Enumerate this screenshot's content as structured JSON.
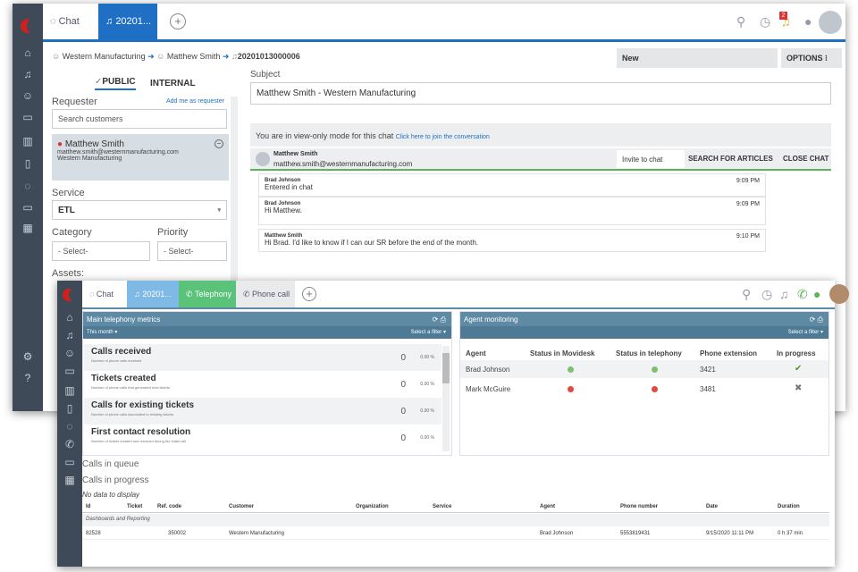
{
  "back": {
    "tabs": {
      "chat": "Chat",
      "ticket": "20201..."
    },
    "notif_count": "2",
    "breadcrumb": {
      "org": "Western Manufacturing",
      "person": "Matthew Smith",
      "ticket": "20201013000006"
    },
    "status": "New",
    "options": "OPTIONS",
    "options_dots": "⁝",
    "public_label": "PUBLIC",
    "internal_label": "INTERNAL",
    "requester_label": "Requester",
    "add_me": "Add me as requester",
    "search_customers": "Search customers",
    "requester": {
      "name": "Matthew Smith",
      "email": "matthew.smith@westernmanufacturing.com",
      "org": "Western Manufacturing"
    },
    "service_label": "Service",
    "service_value": "ETL",
    "category_label": "Category",
    "priority_label": "Priority",
    "category_value": "- Select-",
    "priority_value": "- Select-",
    "assets_label": "Assets:",
    "subject_label": "Subject",
    "subject_value": "Matthew Smith - Western Manufacturing",
    "viewonly_text": "You are in view-only mode for this chat",
    "join_link": "Click here to join the conversation",
    "chat_header": {
      "name": "Matthew Smith",
      "email": "matthew.smith@westernmanufacturing.com"
    },
    "invite_button": "Invite to chat",
    "search_articles": "SEARCH FOR ARTICLES",
    "close_chat": "CLOSE CHAT",
    "messages": [
      {
        "author": "Brad Johnson",
        "text": "Entered in chat",
        "time": "9:09 PM"
      },
      {
        "author": "Brad Johnson",
        "text": "Hi Matthew.",
        "time": "9:09 PM"
      },
      {
        "author": "Matthew Smith",
        "text": "Hi Brad. I'd like to know if I can our SR before the end of the month.",
        "time": "9:10 PM"
      }
    ]
  },
  "front": {
    "tabs": {
      "chat": "Chat",
      "ticket": "20201...",
      "telephony": "Telephony",
      "phone_call": "Phone call"
    },
    "metrics": {
      "title": "Main telephony metrics",
      "period": "This month ▾",
      "filter": "Select a filter ▾",
      "rows": [
        {
          "title": "Calls received",
          "desc": "Number of phone calls received",
          "value": "0",
          "pct": "0.00 %"
        },
        {
          "title": "Tickets created",
          "desc": "Number of phone calls that generated new tickets",
          "value": "0",
          "pct": "0.00 %"
        },
        {
          "title": "Calls for existing tickets",
          "desc": "Number of phone calls associated to existing tickets",
          "value": "0",
          "pct": "0.00 %"
        },
        {
          "title": "First contact resolution",
          "desc": "Number of tickets created and resolved during the initial call",
          "value": "0",
          "pct": "0.00 %"
        }
      ]
    },
    "agents": {
      "title": "Agent monitoring",
      "filter": "Select a filter ▾",
      "headers": [
        "Agent",
        "Status in Movidesk",
        "Status in telephony",
        "Phone extension",
        "In progress"
      ],
      "rows": [
        {
          "agent": "Brad Johnson",
          "movidesk": "#7cc26e",
          "telephony": "#7cc26e",
          "ext": "3421",
          "progress": "✔"
        },
        {
          "agent": "Mark McGuire",
          "movidesk": "#e04a3c",
          "telephony": "#e04a3c",
          "ext": "3481",
          "progress": "✖"
        }
      ]
    },
    "calls_in_queue": "Calls in queue",
    "calls_in_progress": "Calls in progress",
    "no_data": "No data to display",
    "table": {
      "headers": [
        "Id",
        "Ticket",
        "Ref. code",
        "Customer",
        "Organization",
        "Service",
        "Agent",
        "Phone number",
        "Date",
        "Duration"
      ],
      "group": "Dashboards and Reporting",
      "row": [
        "82528",
        "",
        "350002",
        "Western Manufacturing",
        "",
        "",
        "Brad Johnson",
        "5553819431",
        "9/15/2020 11:11 PM",
        "0 h 37 min"
      ]
    }
  }
}
